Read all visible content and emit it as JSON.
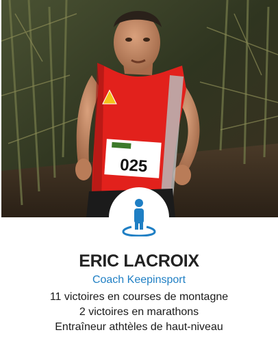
{
  "coach": {
    "name": "ERIC LACROIX",
    "role": "Coach Keepinsport",
    "bib_number": "025",
    "achievements": [
      "11 victoires en courses de montagne",
      "2 victoires en marathons",
      "Entraîneur athtèles de haut-niveau"
    ]
  },
  "icons": {
    "badge": "person-location-icon"
  },
  "colors": {
    "accent": "#1f7fc4",
    "name_text": "#222222",
    "body_text": "#1a1a1a",
    "jersey": "#e2211c"
  }
}
